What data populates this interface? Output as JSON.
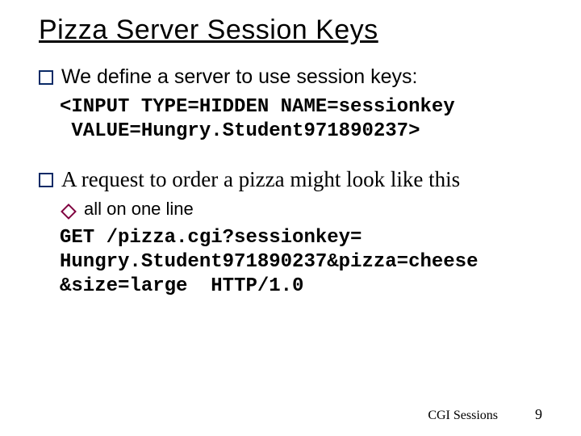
{
  "title": "Pizza Server Session Keys",
  "bullets": {
    "b1": "We define a server to use session keys:",
    "code1": "<INPUT TYPE=HIDDEN NAME=sessionkey\n VALUE=Hungry.Student971890237>",
    "b2": "A request to order a pizza might look like this",
    "sub1": "all on one line",
    "code2": "GET /pizza.cgi?sessionkey=\nHungry.Student971890237&pizza=cheese\n&size=large  HTTP/1.0"
  },
  "footer": {
    "label": "CGI Sessions",
    "page": "9"
  }
}
